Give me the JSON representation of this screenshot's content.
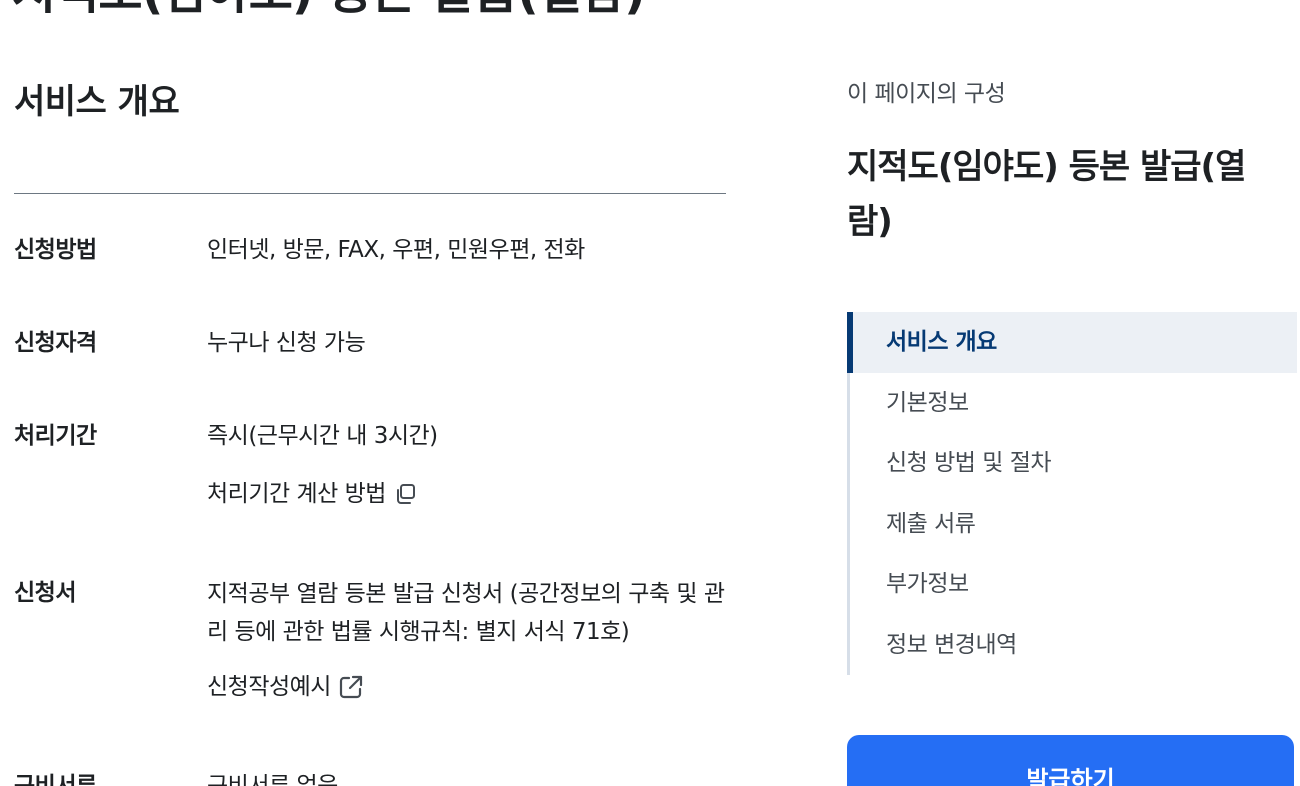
{
  "page": {
    "title": "지적도(임야도) 등본 발급(열람)"
  },
  "overview": {
    "heading": "서비스 개요",
    "rows": [
      {
        "label": "신청방법",
        "value": "인터넷, 방문, FAX, 우편, 민원우편, 전화"
      },
      {
        "label": "신청자격",
        "value": "누구나 신청 가능"
      },
      {
        "label": "처리기간",
        "value": "즉시(근무시간 내 3시간)",
        "link": {
          "label": "처리기간 계산 방법",
          "icon": "copy-icon"
        }
      },
      {
        "label": "신청서",
        "value": "지적공부 열람 등본 발급 신청서 (공간정보의 구축 및 관리 등에 관한 법률 시행규칙: 별지 서식 71호)",
        "link": {
          "label": "신청작성예시",
          "icon": "external-link-icon"
        }
      },
      {
        "label": "구비서류",
        "value": "구비서류 없음"
      }
    ]
  },
  "toc": {
    "caption": "이 페이지의 구성",
    "title": "지적도(임야도) 등본 발급(열람)",
    "items": [
      {
        "label": "서비스 개요",
        "active": true
      },
      {
        "label": "기본정보",
        "active": false
      },
      {
        "label": "신청 방법 및 절차",
        "active": false
      },
      {
        "label": "제출 서류",
        "active": false
      },
      {
        "label": "부가정보",
        "active": false
      },
      {
        "label": "정보 변경내역",
        "active": false
      }
    ]
  },
  "actions": {
    "apply_label": "발급하기"
  },
  "colors": {
    "primary": "#256ef4",
    "toc_active_text": "#063a74",
    "toc_active_bg": "#ecf0f5",
    "text": "#1e2124"
  }
}
